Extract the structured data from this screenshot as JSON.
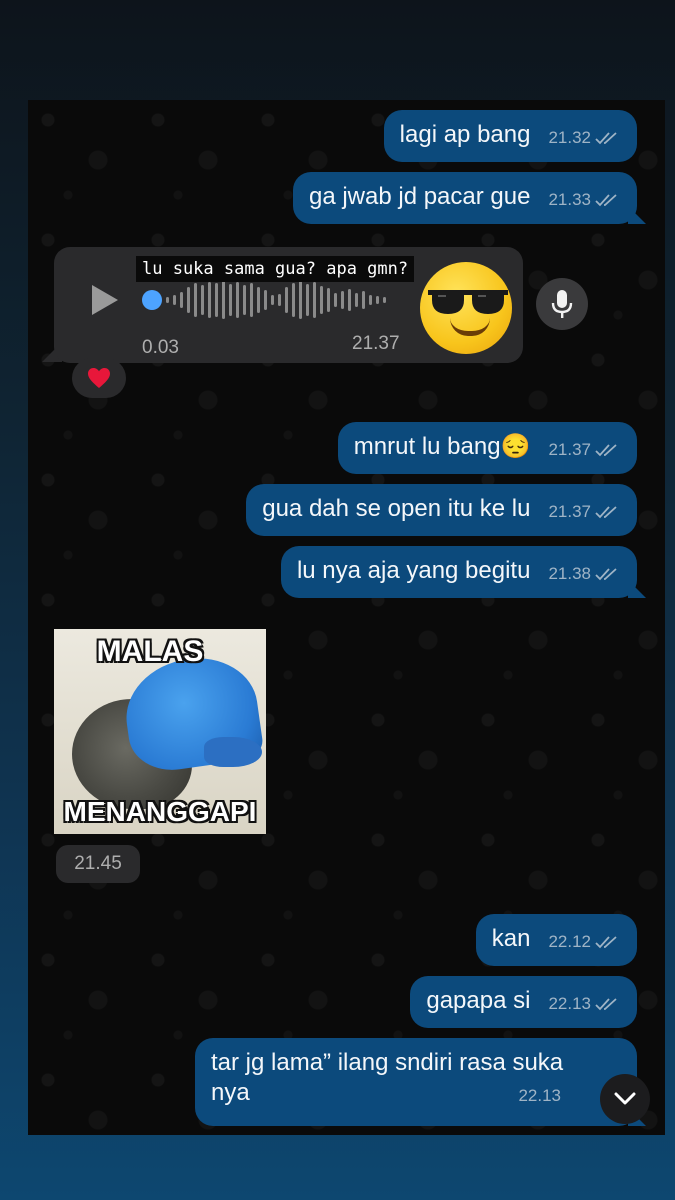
{
  "messages_out_top": [
    {
      "text": "lagi ap bang",
      "time": "21.32"
    },
    {
      "text": "ga jwab jd pacar gue",
      "time": "21.33"
    }
  ],
  "voice_message": {
    "caption": "lu suka sama gua? apa gmn?",
    "duration": "0.03",
    "time": "21.37",
    "progress": 0.02
  },
  "reaction": {
    "icon": "red-heart"
  },
  "messages_out_mid": [
    {
      "text": "mnrut lu bang",
      "emoji": "😔",
      "time": "21.37"
    },
    {
      "text": "gua dah se open itu ke lu",
      "time": "21.37"
    },
    {
      "text": "lu nya aja yang begitu",
      "time": "21.38"
    }
  ],
  "sticker": {
    "top_text": "MALAS",
    "bottom_text": "MENANGGAPI",
    "time": "21.45"
  },
  "messages_out_bottom": [
    {
      "text": "kan",
      "time": "22.12"
    },
    {
      "text": "gapapa si",
      "time": "22.13"
    },
    {
      "text_line1": "tar jg lama” ilang sndiri rasa suka",
      "text_line2": "nya",
      "time": "22.13"
    }
  ],
  "colors": {
    "outgoing_bubble": "#0c4a7c",
    "incoming_bubble": "#2a2a2c",
    "read_ticks": "#9fb4c6"
  }
}
